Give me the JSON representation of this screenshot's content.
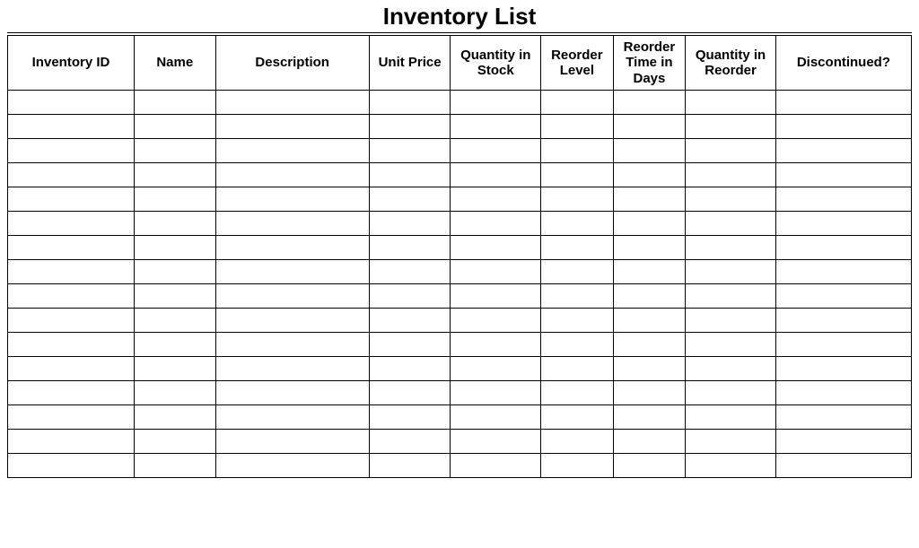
{
  "title": "Inventory List",
  "columns": [
    {
      "key": "inventory_id",
      "label": "Inventory ID"
    },
    {
      "key": "name",
      "label": "Name"
    },
    {
      "key": "description",
      "label": "Description"
    },
    {
      "key": "unit_price",
      "label": "Unit Price"
    },
    {
      "key": "quantity_in_stock",
      "label": "Quantity in Stock"
    },
    {
      "key": "reorder_level",
      "label": "Reorder Level"
    },
    {
      "key": "reorder_time_in_days",
      "label": "Reorder Time in Days"
    },
    {
      "key": "quantity_in_reorder",
      "label": "Quantity in Reorder"
    },
    {
      "key": "discontinued",
      "label": "Discontinued?"
    }
  ],
  "rows": [
    {
      "inventory_id": "",
      "name": "",
      "description": "",
      "unit_price": "",
      "quantity_in_stock": "",
      "reorder_level": "",
      "reorder_time_in_days": "",
      "quantity_in_reorder": "",
      "discontinued": ""
    },
    {
      "inventory_id": "",
      "name": "",
      "description": "",
      "unit_price": "",
      "quantity_in_stock": "",
      "reorder_level": "",
      "reorder_time_in_days": "",
      "quantity_in_reorder": "",
      "discontinued": ""
    },
    {
      "inventory_id": "",
      "name": "",
      "description": "",
      "unit_price": "",
      "quantity_in_stock": "",
      "reorder_level": "",
      "reorder_time_in_days": "",
      "quantity_in_reorder": "",
      "discontinued": ""
    },
    {
      "inventory_id": "",
      "name": "",
      "description": "",
      "unit_price": "",
      "quantity_in_stock": "",
      "reorder_level": "",
      "reorder_time_in_days": "",
      "quantity_in_reorder": "",
      "discontinued": ""
    },
    {
      "inventory_id": "",
      "name": "",
      "description": "",
      "unit_price": "",
      "quantity_in_stock": "",
      "reorder_level": "",
      "reorder_time_in_days": "",
      "quantity_in_reorder": "",
      "discontinued": ""
    },
    {
      "inventory_id": "",
      "name": "",
      "description": "",
      "unit_price": "",
      "quantity_in_stock": "",
      "reorder_level": "",
      "reorder_time_in_days": "",
      "quantity_in_reorder": "",
      "discontinued": ""
    },
    {
      "inventory_id": "",
      "name": "",
      "description": "",
      "unit_price": "",
      "quantity_in_stock": "",
      "reorder_level": "",
      "reorder_time_in_days": "",
      "quantity_in_reorder": "",
      "discontinued": ""
    },
    {
      "inventory_id": "",
      "name": "",
      "description": "",
      "unit_price": "",
      "quantity_in_stock": "",
      "reorder_level": "",
      "reorder_time_in_days": "",
      "quantity_in_reorder": "",
      "discontinued": ""
    },
    {
      "inventory_id": "",
      "name": "",
      "description": "",
      "unit_price": "",
      "quantity_in_stock": "",
      "reorder_level": "",
      "reorder_time_in_days": "",
      "quantity_in_reorder": "",
      "discontinued": ""
    },
    {
      "inventory_id": "",
      "name": "",
      "description": "",
      "unit_price": "",
      "quantity_in_stock": "",
      "reorder_level": "",
      "reorder_time_in_days": "",
      "quantity_in_reorder": "",
      "discontinued": ""
    },
    {
      "inventory_id": "",
      "name": "",
      "description": "",
      "unit_price": "",
      "quantity_in_stock": "",
      "reorder_level": "",
      "reorder_time_in_days": "",
      "quantity_in_reorder": "",
      "discontinued": ""
    },
    {
      "inventory_id": "",
      "name": "",
      "description": "",
      "unit_price": "",
      "quantity_in_stock": "",
      "reorder_level": "",
      "reorder_time_in_days": "",
      "quantity_in_reorder": "",
      "discontinued": ""
    },
    {
      "inventory_id": "",
      "name": "",
      "description": "",
      "unit_price": "",
      "quantity_in_stock": "",
      "reorder_level": "",
      "reorder_time_in_days": "",
      "quantity_in_reorder": "",
      "discontinued": ""
    },
    {
      "inventory_id": "",
      "name": "",
      "description": "",
      "unit_price": "",
      "quantity_in_stock": "",
      "reorder_level": "",
      "reorder_time_in_days": "",
      "quantity_in_reorder": "",
      "discontinued": ""
    },
    {
      "inventory_id": "",
      "name": "",
      "description": "",
      "unit_price": "",
      "quantity_in_stock": "",
      "reorder_level": "",
      "reorder_time_in_days": "",
      "quantity_in_reorder": "",
      "discontinued": ""
    },
    {
      "inventory_id": "",
      "name": "",
      "description": "",
      "unit_price": "",
      "quantity_in_stock": "",
      "reorder_level": "",
      "reorder_time_in_days": "",
      "quantity_in_reorder": "",
      "discontinued": ""
    }
  ]
}
